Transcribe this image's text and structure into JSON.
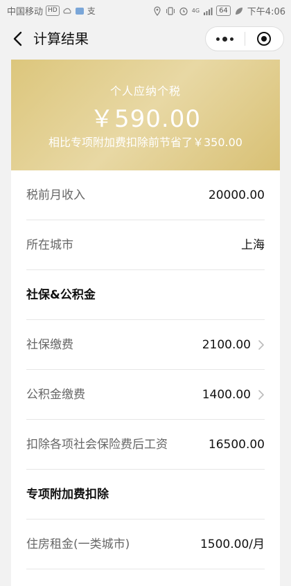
{
  "status_bar": {
    "carrier": "中国移动",
    "hd_badge": "HD",
    "alipay_glyph": "支",
    "signal_tag": "4G",
    "battery": "64",
    "time": "下午4:06"
  },
  "nav": {
    "title": "计算结果"
  },
  "result": {
    "label": "个人应纳个税",
    "amount": "￥590.00",
    "savings_note": "相比专项附加费扣除前节省了￥350.00"
  },
  "rows": [
    {
      "label": "税前月收入",
      "value": "20000.00",
      "arrow": false,
      "section": false
    },
    {
      "label": "所在城市",
      "value": "上海",
      "arrow": false,
      "section": false
    },
    {
      "label": "社保&公积金",
      "value": "",
      "arrow": false,
      "section": true
    },
    {
      "label": "社保缴费",
      "value": "2100.00",
      "arrow": true,
      "section": false
    },
    {
      "label": "公积金缴费",
      "value": "1400.00",
      "arrow": true,
      "section": false
    },
    {
      "label": "扣除各项社会保险费后工资",
      "value": "16500.00",
      "arrow": false,
      "section": false
    },
    {
      "label": "专项附加费扣除",
      "value": "",
      "arrow": false,
      "section": true
    },
    {
      "label": "住房租金(一类城市)",
      "value": "1500.00/月",
      "arrow": false,
      "section": false
    }
  ],
  "colors": {
    "banner_gold": "#dcc67c",
    "page_bg": "#f2f2f2",
    "text_muted": "#666666"
  }
}
